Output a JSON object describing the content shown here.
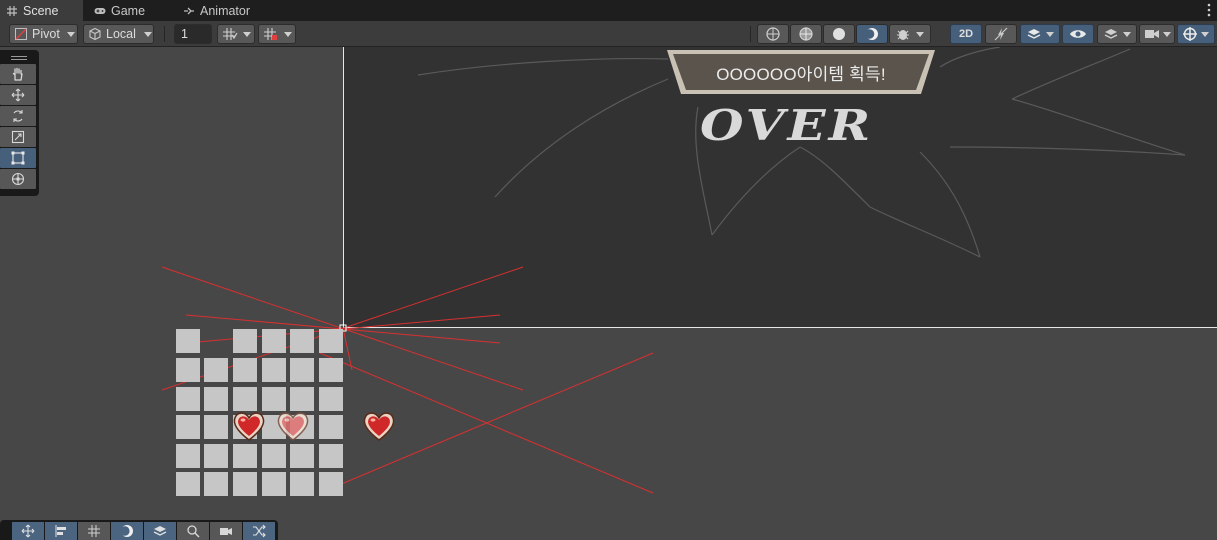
{
  "tabs": [
    {
      "label": "Scene",
      "icon": "grid-icon",
      "active": true
    },
    {
      "label": "Game",
      "icon": "gamepad-icon",
      "active": false
    },
    {
      "label": "Animator",
      "icon": "animator-icon",
      "active": false
    }
  ],
  "toolbar": {
    "pivot_label": "Pivot",
    "local_label": "Local",
    "snap_value": "1",
    "mode_2d_label": "2D"
  },
  "scene": {
    "banner_text": "OOOOOO아이템 획득!",
    "over_text": "OVER"
  },
  "colors": {
    "accent_blue": "#46607c",
    "selection_red": "#e03030",
    "canvas_bg": "#323232",
    "viewport_bg": "#474747"
  },
  "tools": [
    "hand-tool",
    "move-tool",
    "rotate-tool",
    "scale-tool",
    "rect-tool",
    "transform-tool"
  ],
  "overlay_buttons": [
    "move-overlay",
    "align-overlay",
    "grid-overlay",
    "shading-overlay",
    "layers-overlay",
    "search-overlay",
    "camera-overlay",
    "shuffle-overlay"
  ]
}
